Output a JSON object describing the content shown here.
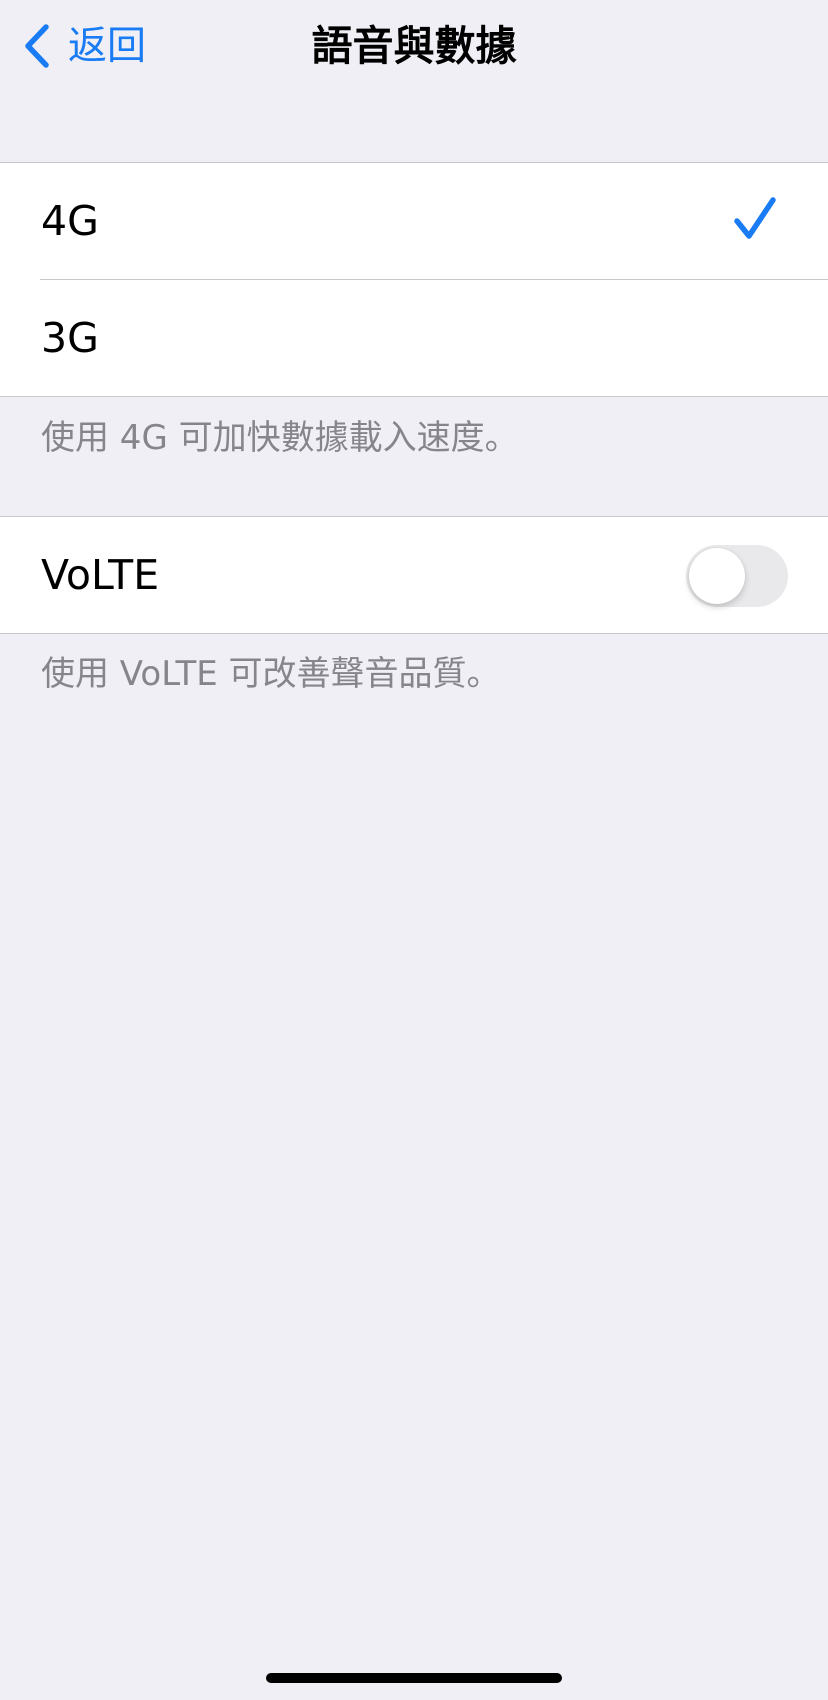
{
  "navbar": {
    "back_label": "返回",
    "back_icon": "chevron-left-icon",
    "title": "語音與數據"
  },
  "network": {
    "options": [
      {
        "label": "4G",
        "selected": true
      },
      {
        "label": "3G",
        "selected": false
      }
    ],
    "check_icon": "checkmark-icon",
    "footer": "使用 4G 可加快數據載入速度。"
  },
  "volte": {
    "label": "VoLTE",
    "enabled": false,
    "footer": "使用 VoLTE 可改善聲音品質。"
  },
  "colors": {
    "accent": "#1a7cf4",
    "background": "#f0eff5",
    "footnote_text": "#86858b",
    "separator": "#c8c7cc",
    "toggle_off": "#e9e9eb"
  }
}
